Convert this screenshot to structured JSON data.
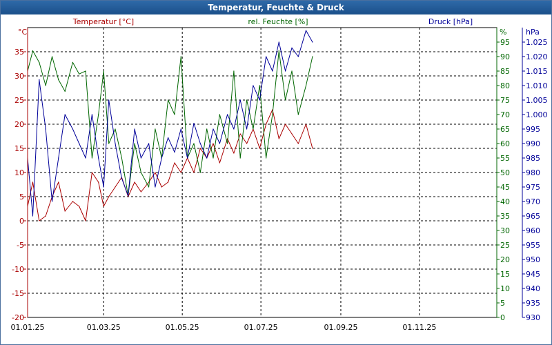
{
  "chart_data": {
    "type": "line",
    "title": "Temperatur, Feuchte & Druck",
    "x_axis": {
      "ticks": [
        "01.01.25",
        "01.03.25",
        "01.05.25",
        "01.07.25",
        "01.09.25",
        "01.11.25"
      ],
      "range": [
        "2025-01-01",
        "2025-12-31"
      ]
    },
    "axes": {
      "temperature": {
        "label": "Temperatur [°C]",
        "unit": "°C",
        "color": "#aa0000",
        "range": [
          -20,
          40
        ],
        "ticks": [
          -20,
          -15,
          -10,
          -5,
          0,
          5,
          10,
          15,
          20,
          25,
          30,
          35
        ]
      },
      "humidity": {
        "label": "rel. Feuchte [%]",
        "unit": "%",
        "color": "#006600",
        "range": [
          0,
          100
        ],
        "ticks": [
          0,
          5,
          10,
          15,
          20,
          25,
          30,
          35,
          40,
          45,
          50,
          55,
          60,
          65,
          70,
          75,
          80,
          85,
          90,
          95
        ]
      },
      "pressure": {
        "label": "Druck [hPa]",
        "unit": "hPa",
        "color": "#000099",
        "range": [
          930,
          1030
        ],
        "ticks": [
          "930",
          "935",
          "940",
          "945",
          "950",
          "955",
          "960",
          "965",
          "970",
          "975",
          "980",
          "985",
          "990",
          "995",
          "1.000",
          "1.005",
          "1.010",
          "1.015",
          "1.020",
          "1.025"
        ]
      }
    },
    "grid": true,
    "series": [
      {
        "name": "Temperatur [°C]",
        "axis": "temperature",
        "color": "#aa0000",
        "x": [
          "2025-01-01",
          "2025-01-05",
          "2025-01-10",
          "2025-01-15",
          "2025-01-20",
          "2025-01-25",
          "2025-01-30",
          "2025-02-05",
          "2025-02-10",
          "2025-02-15",
          "2025-02-20",
          "2025-02-25",
          "2025-03-01",
          "2025-03-05",
          "2025-03-10",
          "2025-03-15",
          "2025-03-20",
          "2025-03-25",
          "2025-03-30",
          "2025-04-05",
          "2025-04-10",
          "2025-04-15",
          "2025-04-20",
          "2025-04-25",
          "2025-04-30",
          "2025-05-05",
          "2025-05-10",
          "2025-05-15",
          "2025-05-20",
          "2025-05-25",
          "2025-05-30",
          "2025-06-05",
          "2025-06-10",
          "2025-06-15",
          "2025-06-20",
          "2025-06-25",
          "2025-06-30",
          "2025-07-05",
          "2025-07-10",
          "2025-07-15",
          "2025-07-20",
          "2025-07-25",
          "2025-07-30",
          "2025-08-05",
          "2025-08-10"
        ],
        "values": [
          3,
          8,
          0,
          1,
          5,
          8,
          2,
          4,
          3,
          0,
          10,
          8,
          3,
          5,
          7,
          9,
          5,
          8,
          6,
          8,
          10,
          7,
          8,
          12,
          10,
          13,
          10,
          15,
          13,
          16,
          12,
          17,
          14,
          18,
          16,
          19,
          15,
          20,
          23,
          17,
          20,
          18,
          16,
          20,
          15
        ]
      },
      {
        "name": "rel. Feuchte [%]",
        "axis": "humidity",
        "color": "#006600",
        "x": [
          "2025-01-01",
          "2025-01-05",
          "2025-01-10",
          "2025-01-15",
          "2025-01-20",
          "2025-01-25",
          "2025-01-30",
          "2025-02-05",
          "2025-02-10",
          "2025-02-15",
          "2025-02-20",
          "2025-02-25",
          "2025-03-01",
          "2025-03-05",
          "2025-03-10",
          "2025-03-15",
          "2025-03-20",
          "2025-03-25",
          "2025-03-30",
          "2025-04-05",
          "2025-04-10",
          "2025-04-15",
          "2025-04-20",
          "2025-04-25",
          "2025-04-30",
          "2025-05-05",
          "2025-05-10",
          "2025-05-15",
          "2025-05-20",
          "2025-05-25",
          "2025-05-30",
          "2025-06-05",
          "2025-06-10",
          "2025-06-15",
          "2025-06-20",
          "2025-06-25",
          "2025-06-30",
          "2025-07-05",
          "2025-07-10",
          "2025-07-15",
          "2025-07-20",
          "2025-07-25",
          "2025-07-30",
          "2025-08-05",
          "2025-08-10"
        ],
        "values": [
          85,
          92,
          88,
          80,
          90,
          82,
          78,
          88,
          84,
          85,
          55,
          70,
          85,
          60,
          65,
          55,
          42,
          60,
          50,
          45,
          65,
          55,
          75,
          70,
          90,
          55,
          60,
          50,
          65,
          55,
          70,
          60,
          85,
          55,
          75,
          65,
          80,
          55,
          70,
          92,
          75,
          85,
          70,
          80,
          90
        ]
      },
      {
        "name": "Druck [hPa]",
        "axis": "pressure",
        "color": "#000099",
        "x": [
          "2025-01-01",
          "2025-01-05",
          "2025-01-10",
          "2025-01-15",
          "2025-01-20",
          "2025-01-25",
          "2025-01-30",
          "2025-02-05",
          "2025-02-10",
          "2025-02-15",
          "2025-02-20",
          "2025-02-25",
          "2025-03-01",
          "2025-03-05",
          "2025-03-10",
          "2025-03-15",
          "2025-03-20",
          "2025-03-25",
          "2025-03-30",
          "2025-04-05",
          "2025-04-10",
          "2025-04-15",
          "2025-04-20",
          "2025-04-25",
          "2025-04-30",
          "2025-05-05",
          "2025-05-10",
          "2025-05-15",
          "2025-05-20",
          "2025-05-25",
          "2025-05-30",
          "2025-06-05",
          "2025-06-10",
          "2025-06-15",
          "2025-06-20",
          "2025-06-25",
          "2025-06-30",
          "2025-07-05",
          "2025-07-10",
          "2025-07-15",
          "2025-07-20",
          "2025-07-25",
          "2025-07-30",
          "2025-08-05",
          "2025-08-10"
        ],
        "values": [
          985,
          965,
          1012,
          995,
          970,
          985,
          1000,
          995,
          990,
          985,
          1000,
          985,
          975,
          1005,
          990,
          978,
          972,
          995,
          985,
          990,
          975,
          985,
          992,
          987,
          995,
          985,
          997,
          990,
          985,
          995,
          990,
          1000,
          995,
          1005,
          995,
          1010,
          1005,
          1020,
          1015,
          1025,
          1015,
          1023,
          1020,
          1029,
          1025
        ]
      }
    ]
  }
}
